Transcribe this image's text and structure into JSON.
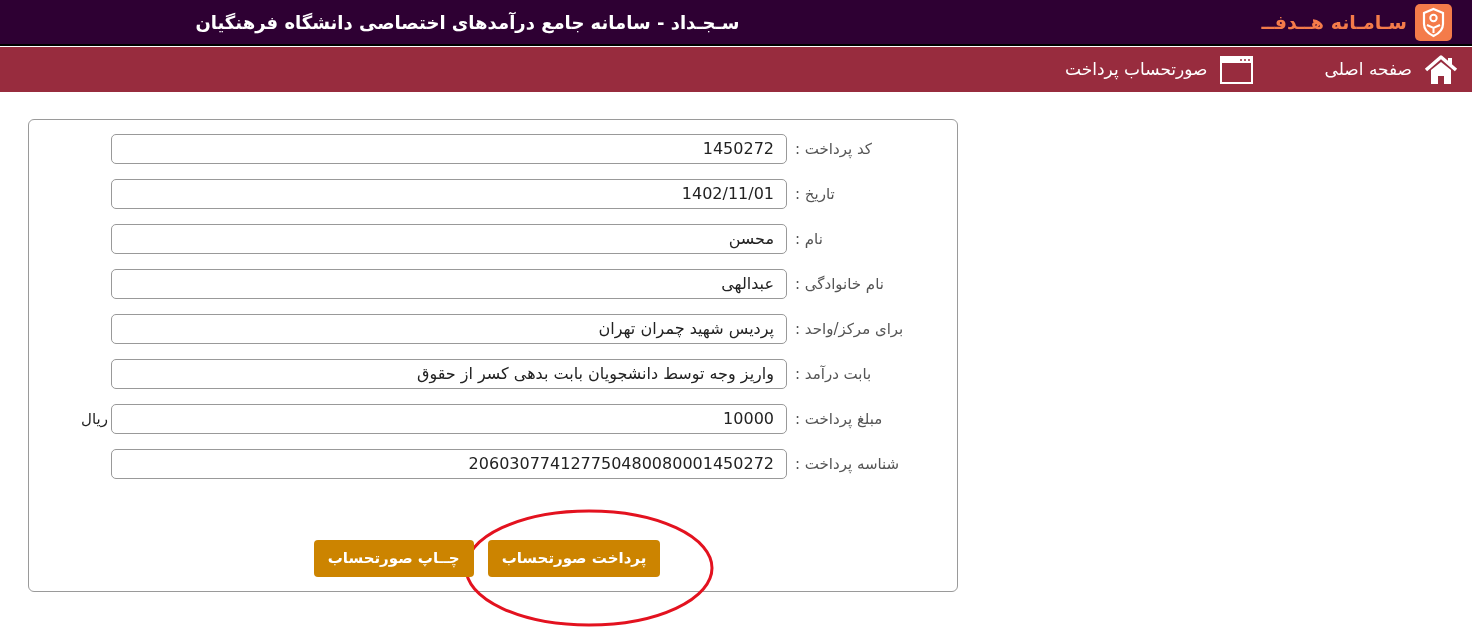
{
  "header": {
    "logo_text": "سـامـانه هــدفــ",
    "title": "سـجـداد - سامانه جامع درآمدهای اختصاصی دانشگاه فرهنگیان"
  },
  "nav": [
    {
      "kind": "home",
      "label": "صفحه اصلی"
    },
    {
      "kind": "page",
      "label": "صورتحساب پرداخت"
    }
  ],
  "form": {
    "fields": [
      {
        "label": "کد پرداخت :",
        "value": "1450272"
      },
      {
        "label": "تاریخ :",
        "value": "1402/11/01"
      },
      {
        "label": "نام :",
        "value": "محسن"
      },
      {
        "label": "نام خانوادگی :",
        "value": "عبدالهی"
      },
      {
        "label": "برای مرکز/واحد :",
        "value": "پردیس شهید چمران تهران"
      },
      {
        "label": "بابت درآمد :",
        "value": "واریز وجه توسط دانشجویان بابت بدهی کسر از حقوق"
      },
      {
        "label": "مبلغ پرداخت :",
        "value": "10000",
        "unit": "ریال"
      },
      {
        "label": "شناسه پرداخت :",
        "value": "206030774127750480080001450272"
      }
    ],
    "buttons": [
      {
        "label": "پرداخت صورتحساب",
        "highlighted": true
      },
      {
        "label": "چــاپ صورتحساب",
        "highlighted": false
      }
    ]
  }
}
